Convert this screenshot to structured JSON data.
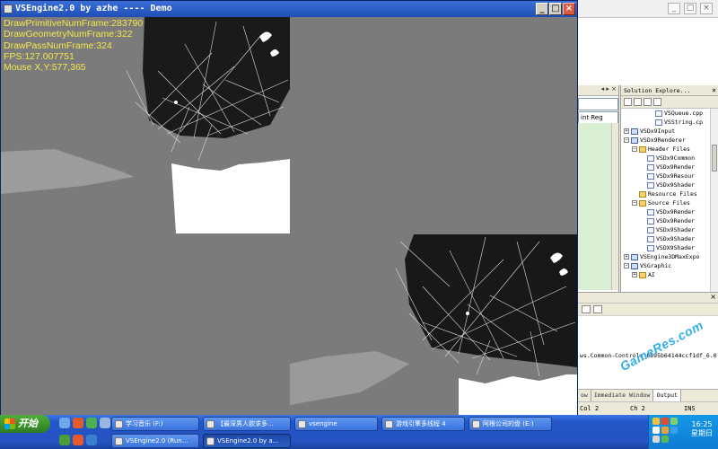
{
  "demo_window": {
    "title": "VSEngine2.0 by azhe ---- Demo",
    "buttons": [
      "_",
      "□",
      "×"
    ]
  },
  "stats": {
    "primitive": "DrawPrimitiveNumFrame:283790",
    "geometry": "DrawGeometryNumFrame:322",
    "pass": "DrawPassNumFrame:324",
    "fps": "FPS:127.007751",
    "mouse": "Mouse X,Y:577,365"
  },
  "ide": {
    "editor_header": "◂ ▸ ×",
    "editor_combo": "int Reg",
    "solution_explorer": {
      "title": "Solution Explore...",
      "close": "×",
      "tree": [
        {
          "indent": 3,
          "expander": "",
          "icon": "file",
          "label": "VSQueue.cpp"
        },
        {
          "indent": 3,
          "expander": "",
          "icon": "file",
          "label": "VSString.cp"
        },
        {
          "indent": 0,
          "expander": "+",
          "icon": "project",
          "label": "VSDx9Input"
        },
        {
          "indent": 0,
          "expander": "−",
          "icon": "project",
          "label": "VSDx9Renderer"
        },
        {
          "indent": 1,
          "expander": "−",
          "icon": "folder",
          "label": "Header Files"
        },
        {
          "indent": 2,
          "expander": "",
          "icon": "file",
          "label": "VSDx9Common"
        },
        {
          "indent": 2,
          "expander": "",
          "icon": "file",
          "label": "VSDx9Render"
        },
        {
          "indent": 2,
          "expander": "",
          "icon": "file",
          "label": "VSDx9Resour"
        },
        {
          "indent": 2,
          "expander": "",
          "icon": "file",
          "label": "VSDx9Shader"
        },
        {
          "indent": 1,
          "expander": "",
          "icon": "folder",
          "label": "Resource Files"
        },
        {
          "indent": 1,
          "expander": "−",
          "icon": "folder",
          "label": "Source Files"
        },
        {
          "indent": 2,
          "expander": "",
          "icon": "file",
          "label": "VSDx9Render"
        },
        {
          "indent": 2,
          "expander": "",
          "icon": "file",
          "label": "VSDx9Render"
        },
        {
          "indent": 2,
          "expander": "",
          "icon": "file",
          "label": "VSDx9Shader"
        },
        {
          "indent": 2,
          "expander": "",
          "icon": "file",
          "label": "VSDx9Shader"
        },
        {
          "indent": 2,
          "expander": "",
          "icon": "file",
          "label": "VSDX9Shader"
        },
        {
          "indent": 0,
          "expander": "+",
          "icon": "project",
          "label": "VSEngine3DMaxExpo"
        },
        {
          "indent": 0,
          "expander": "−",
          "icon": "project",
          "label": "VSGraphic"
        },
        {
          "indent": 1,
          "expander": "+",
          "icon": "folder",
          "label": "AI"
        }
      ]
    },
    "output": {
      "close": "×",
      "text": "ws.Common-Controls_6595b64144ccf1df_6.0",
      "tabs": [
        "ow",
        "Immediate Window",
        "Output"
      ],
      "active_tab": "Output"
    },
    "status": {
      "col": "Col 2",
      "ch": "Ch 2",
      "ins": "INS"
    }
  },
  "taskbar": {
    "start": "开始",
    "tasks_row1": [
      "学习音乐 (F:)",
      "【最深男人欲求多...",
      "vsengine",
      "游戏引擎多线程 4",
      "阿根公司的盘 (E:)"
    ],
    "tasks_row2": [
      "VSEngine2.0 (Run...",
      "VSEngine2.0 by a..."
    ],
    "clock": {
      "time": "16:25",
      "day": "星期日"
    }
  },
  "watermark": "GameRes.com",
  "colors": {
    "stats_text": "#f4e94a",
    "viewport_bg": "#7b7b7b",
    "titlebar": "#1f4fb5",
    "taskbar": "#2453c2"
  }
}
